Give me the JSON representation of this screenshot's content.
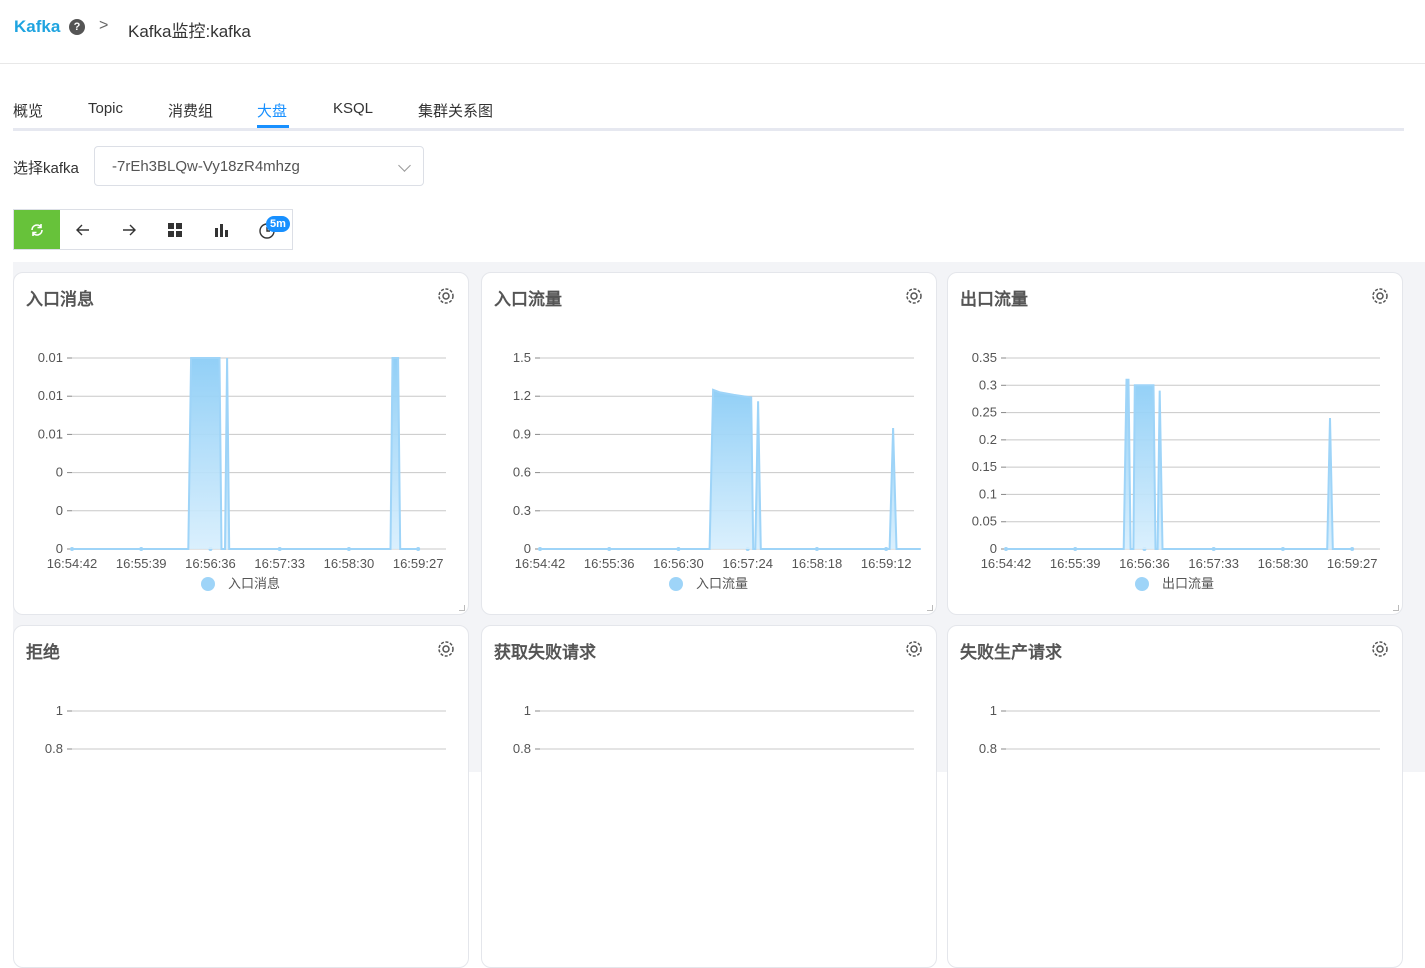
{
  "header": {
    "brand": "Kafka",
    "help_icon": "question-circle-icon",
    "separator": ">",
    "title": "Kafka监控:kafka"
  },
  "tabs": [
    {
      "label": "概览"
    },
    {
      "label": "Topic"
    },
    {
      "label": "消费组"
    },
    {
      "label": "大盘",
      "active": true
    },
    {
      "label": "KSQL"
    },
    {
      "label": "集群关系图"
    }
  ],
  "selector": {
    "label": "选择kafka",
    "value": "-7rEh3BLQw-Vy18zR4mhzg"
  },
  "toolbar": {
    "buttons": [
      "refresh-icon",
      "arrow-left-icon",
      "arrow-right-icon",
      "grid-icon",
      "bar-chart-icon",
      "clock-icon"
    ],
    "interval_badge": "5m"
  },
  "colors": {
    "accent": "#1890ff",
    "series": "#9ed4f8",
    "refresh": "#67c23a"
  },
  "charts": [
    {
      "title": "入口消息",
      "chart_data": {
        "type": "area",
        "x_ticks": [
          "16:54:42",
          "16:55:39",
          "16:56:36",
          "16:57:33",
          "16:58:30",
          "16:59:27"
        ],
        "y_ticks": [
          "0",
          "0",
          "0",
          "0.01",
          "0.01",
          "0.01"
        ],
        "ylim": [
          0,
          0.01
        ],
        "series": [
          {
            "name": "入口消息",
            "x": [
              0,
              1.68,
              1.72,
              2.13,
              2.16,
              2.21,
              2.24,
              2.27,
              2.3,
              2.33,
              2.37,
              4.6,
              4.63,
              4.71,
              4.74,
              5.0
            ],
            "values": [
              0,
              0,
              0.01,
              0.01,
              0,
              0,
              0.01,
              0,
              0,
              0,
              0,
              0,
              0.01,
              0.01,
              0,
              0
            ]
          }
        ],
        "legend": "bottom"
      }
    },
    {
      "title": "入口流量",
      "chart_data": {
        "type": "area",
        "x_ticks": [
          "16:54:42",
          "16:55:36",
          "16:56:30",
          "16:57:24",
          "16:58:18",
          "16:59:12"
        ],
        "y_ticks": [
          "0",
          "0.3",
          "0.6",
          "0.9",
          "1.2",
          "1.5"
        ],
        "ylim": [
          0,
          1.5
        ],
        "series": [
          {
            "name": "入口流量",
            "x": [
              0,
              2.45,
              2.5,
              2.6,
              2.8,
              3.05,
              3.08,
              3.11,
              3.15,
              3.19,
              3.23,
              5.05,
              5.1,
              5.15,
              5.5
            ],
            "values": [
              0,
              0,
              1.25,
              1.23,
              1.21,
              1.19,
              0,
              0,
              1.16,
              0,
              0,
              0,
              0.95,
              0,
              0
            ]
          }
        ],
        "legend": "bottom"
      }
    },
    {
      "title": "出口流量",
      "chart_data": {
        "type": "area",
        "x_ticks": [
          "16:54:42",
          "16:55:39",
          "16:56:36",
          "16:57:33",
          "16:58:30",
          "16:59:27"
        ],
        "y_ticks": [
          "0",
          "0.05",
          "0.1",
          "0.15",
          "0.2",
          "0.25",
          "0.3",
          "0.35"
        ],
        "ylim": [
          0,
          0.35
        ],
        "series": [
          {
            "name": "出口流量",
            "x": [
              0,
              1.7,
              1.74,
              1.77,
              1.8,
              1.84,
              1.86,
              2.13,
              2.16,
              2.19,
              2.22,
              2.26,
              2.3,
              4.64,
              4.68,
              4.72,
              5.0
            ],
            "values": [
              0,
              0,
              0.31,
              0.31,
              0,
              0,
              0.3,
              0.3,
              0,
              0,
              0.29,
              0,
              0,
              0,
              0.24,
              0,
              0
            ]
          }
        ],
        "legend": "bottom"
      }
    },
    {
      "title": "拒绝",
      "chart_data": {
        "type": "area",
        "y_ticks": [
          "1",
          "0.8"
        ],
        "series": []
      }
    },
    {
      "title": "获取失败请求",
      "chart_data": {
        "type": "area",
        "y_ticks": [
          "1",
          "0.8"
        ],
        "series": []
      }
    },
    {
      "title": "失败生产请求",
      "chart_data": {
        "type": "area",
        "y_ticks": [
          "1",
          "0.8"
        ],
        "series": []
      }
    }
  ]
}
